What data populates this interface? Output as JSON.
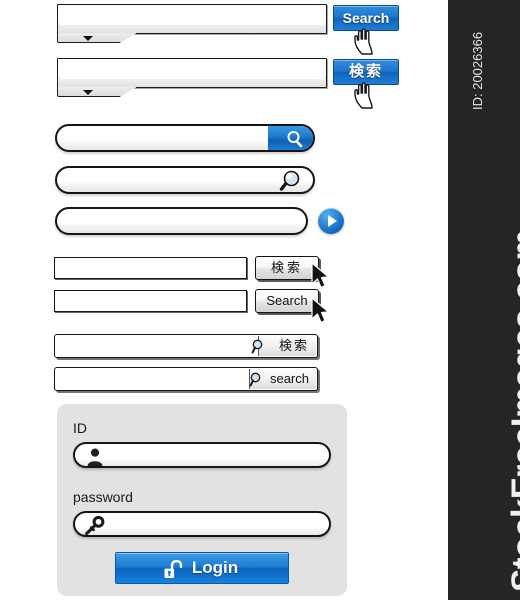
{
  "watermark": {
    "brand": "StockFreeImages.com",
    "id_label": "ID: 20026366",
    "bar_color": "#252525",
    "text_color": "#f2f2f2"
  },
  "theme": {
    "accent_blue": "#1d76cc",
    "accent_blue_dark": "#0d63bf",
    "panel_grey": "#e2e2e2",
    "outline_black": "#151515"
  },
  "rows": {
    "boxed_dropdown_en": {
      "name": "boxed-search-with-dropdown-english",
      "input_value": "",
      "input_placeholder": "",
      "dropdown_icon": "chevron-down-icon",
      "button_label": "Search",
      "cursor_icon": "hand-pointer-cursor"
    },
    "boxed_dropdown_jp": {
      "name": "boxed-search-with-dropdown-japanese",
      "input_value": "",
      "input_placeholder": "",
      "dropdown_icon": "chevron-down-icon",
      "button_label": "検索",
      "cursor_icon": "hand-pointer-cursor"
    },
    "pill_blue_cap": {
      "name": "pill-search-blue-cap",
      "input_value": "",
      "input_placeholder": "",
      "icon": "magnifier-icon-white"
    },
    "pill_glass_icon": {
      "name": "pill-search-glass-magnifier",
      "input_value": "",
      "input_placeholder": "",
      "icon": "magnifier-icon-glass"
    },
    "pill_go_button": {
      "name": "pill-search-go-arrow",
      "input_value": "",
      "input_placeholder": "",
      "icon": "play-arrow-icon"
    },
    "flat_btn_jp": {
      "name": "flat-input-grey-button-japanese",
      "input_value": "",
      "input_placeholder": "",
      "button_label": "検索",
      "cursor_icon": "arrow-cursor"
    },
    "flat_btn_en": {
      "name": "flat-input-grey-button-english",
      "input_value": "",
      "input_placeholder": "",
      "button_label": "Search",
      "cursor_icon": "arrow-cursor"
    },
    "inset_btn_jp": {
      "name": "framed-input-inset-button-japanese",
      "input_value": "",
      "input_placeholder": "",
      "button_label": "検索",
      "icon": "magnifier-icon-small"
    },
    "inset_btn_en": {
      "name": "framed-input-inset-button-english",
      "input_value": "",
      "input_placeholder": "",
      "button_label": "search",
      "icon": "magnifier-icon-small"
    }
  },
  "login": {
    "id_label": "ID",
    "id_value": "",
    "id_placeholder": "",
    "id_icon": "user-silhouette-icon",
    "password_label": "password",
    "password_value": "",
    "password_placeholder": "",
    "password_icon": "key-icon",
    "button_label": "Login",
    "button_icon": "open-padlock-icon"
  }
}
